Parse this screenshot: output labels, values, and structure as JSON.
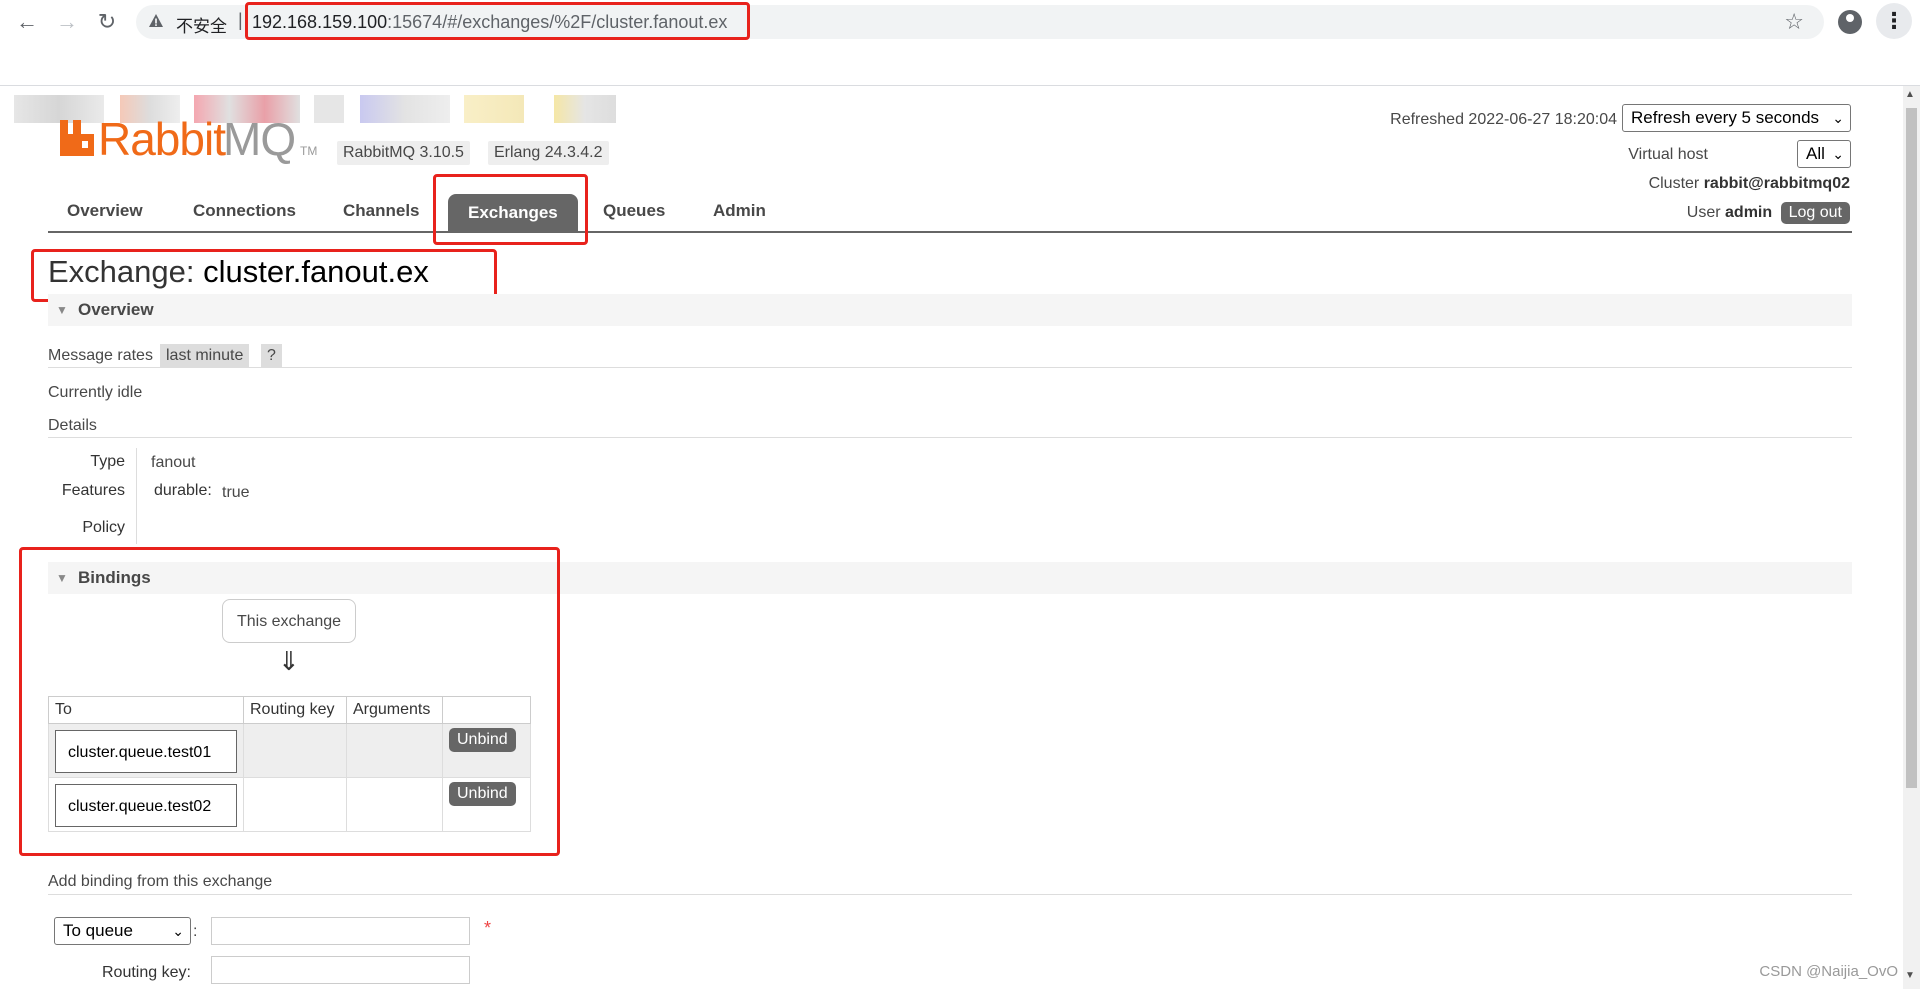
{
  "browser": {
    "insecure_label": "不安全",
    "url_host": "192.168.159.100",
    "url_rest": ":15674/#/exchanges/%2F/cluster.fanout.ex"
  },
  "header": {
    "logo_rabbit": "Rabbit",
    "logo_mq": "MQ",
    "logo_tm": "TM",
    "version_badge": "RabbitMQ 3.10.5",
    "erlang_badge": "Erlang 24.3.4.2",
    "refreshed_text": "Refreshed 2022-06-27 18:20:04",
    "refresh_select": "Refresh every 5 seconds",
    "vhost_label": "Virtual host",
    "vhost_select": "All",
    "cluster_label": "Cluster",
    "cluster_value": "rabbit@rabbitmq02",
    "user_label": "User",
    "user_value": "admin",
    "logout_label": "Log out"
  },
  "tabs": [
    {
      "label": "Overview"
    },
    {
      "label": "Connections"
    },
    {
      "label": "Channels"
    },
    {
      "label": "Exchanges"
    },
    {
      "label": "Queues"
    },
    {
      "label": "Admin"
    }
  ],
  "page": {
    "title_prefix": "Exchange:",
    "title_name": "cluster.fanout.ex"
  },
  "overview": {
    "section_label": "Overview",
    "message_rates_label": "Message rates",
    "message_rates_value": "last minute",
    "help_label": "?",
    "idle_text": "Currently idle",
    "details_label": "Details",
    "type_label": "Type",
    "type_value": "fanout",
    "features_label": "Features",
    "durable_key": "durable:",
    "durable_value": "true",
    "policy_label": "Policy"
  },
  "bindings": {
    "section_label": "Bindings",
    "this_exchange": "This exchange",
    "arrow": "⇓",
    "columns": [
      "To",
      "Routing key",
      "Arguments",
      ""
    ],
    "rows": [
      {
        "to": "cluster.queue.test01",
        "routing_key": "",
        "arguments": "",
        "action": "Unbind"
      },
      {
        "to": "cluster.queue.test02",
        "routing_key": "",
        "arguments": "",
        "action": "Unbind"
      }
    ]
  },
  "add_binding": {
    "title": "Add binding from this exchange",
    "destination_select": "To queue",
    "colon": ":",
    "required_mark": "*",
    "routing_key_label": "Routing key:"
  },
  "watermark": "CSDN @Naijia_OvO",
  "colors": {
    "highlight": "#e8221c",
    "brand_orange": "#f06a18",
    "tab_active_bg": "#666666"
  }
}
